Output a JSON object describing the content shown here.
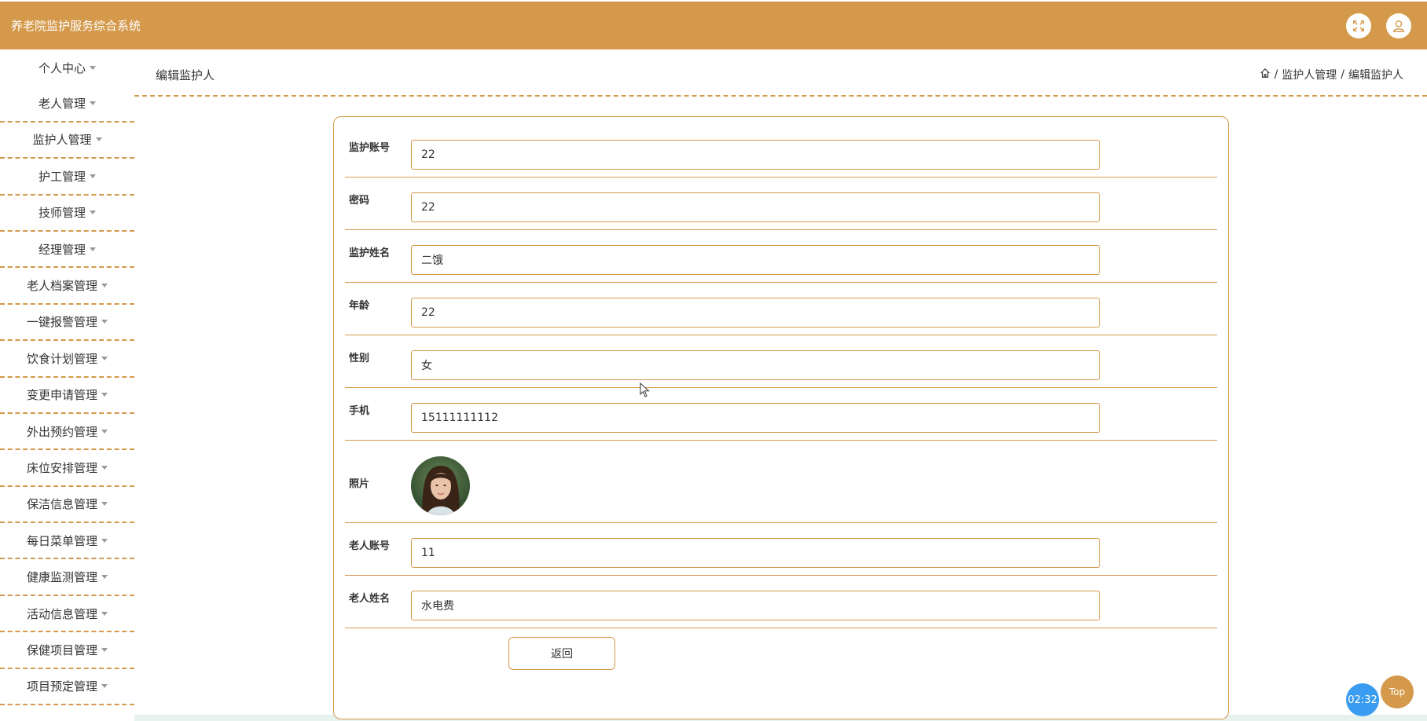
{
  "header": {
    "app_title": "养老院监护服务综合系统",
    "fullscreen_icon": "expand-icon",
    "user_icon": "user-icon",
    "accent_color": "#d4994b"
  },
  "sidebar": {
    "items": [
      {
        "label": "个人中心"
      },
      {
        "label": "老人管理"
      },
      {
        "label": "监护人管理"
      },
      {
        "label": "护工管理"
      },
      {
        "label": "技师管理"
      },
      {
        "label": "经理管理"
      },
      {
        "label": "老人档案管理"
      },
      {
        "label": "一键报警管理"
      },
      {
        "label": "饮食计划管理"
      },
      {
        "label": "变更申请管理"
      },
      {
        "label": "外出预约管理"
      },
      {
        "label": "床位安排管理"
      },
      {
        "label": "保洁信息管理"
      },
      {
        "label": "每日菜单管理"
      },
      {
        "label": "健康监测管理"
      },
      {
        "label": "活动信息管理"
      },
      {
        "label": "保健项目管理"
      },
      {
        "label": "项目预定管理"
      }
    ]
  },
  "topbar": {
    "page_title": "编辑监护人",
    "breadcrumb": {
      "home_icon": "home-icon",
      "separator": "/",
      "section": "监护人管理",
      "current": "编辑监护人"
    }
  },
  "form": {
    "fields": [
      {
        "label": "监护账号",
        "value": "22"
      },
      {
        "label": "密码",
        "value": "22"
      },
      {
        "label": "监护姓名",
        "value": "二饿"
      },
      {
        "label": "年龄",
        "value": "22"
      },
      {
        "label": "性别",
        "value": "女"
      },
      {
        "label": "手机",
        "value": "15111111112"
      }
    ],
    "photo_label": "照片",
    "fields_after": [
      {
        "label": "老人账号",
        "value": "11"
      },
      {
        "label": "老人姓名",
        "value": "水电费"
      }
    ],
    "back_label": "返回"
  },
  "floating": {
    "timer": "02:32",
    "top_label": "Top"
  }
}
